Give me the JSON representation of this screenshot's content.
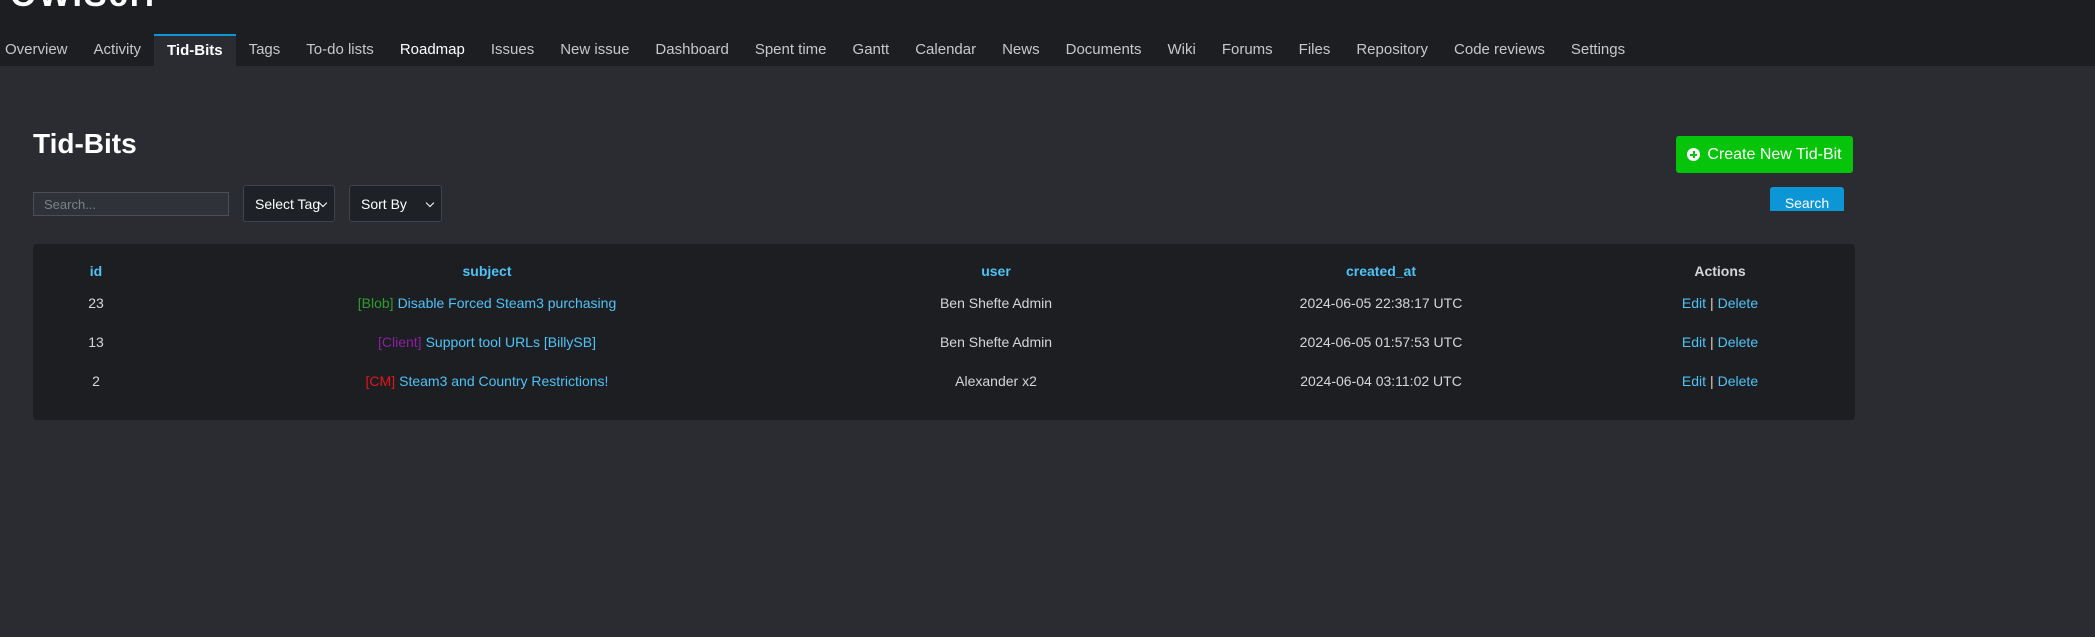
{
  "app": {
    "title": "OWIScrl"
  },
  "nav": {
    "tabs": [
      {
        "label": "Overview"
      },
      {
        "label": "Activity"
      },
      {
        "label": "Tid-Bits"
      },
      {
        "label": "Tags"
      },
      {
        "label": "To-do lists"
      },
      {
        "label": "Roadmap"
      },
      {
        "label": "Issues"
      },
      {
        "label": "New issue"
      },
      {
        "label": "Dashboard"
      },
      {
        "label": "Spent time"
      },
      {
        "label": "Gantt"
      },
      {
        "label": "Calendar"
      },
      {
        "label": "News"
      },
      {
        "label": "Documents"
      },
      {
        "label": "Wiki"
      },
      {
        "label": "Forums"
      },
      {
        "label": "Files"
      },
      {
        "label": "Repository"
      },
      {
        "label": "Code reviews"
      },
      {
        "label": "Settings"
      }
    ],
    "active": "Tid-Bits"
  },
  "page": {
    "title": "Tid-Bits",
    "create_button": "Create New Tid-Bit",
    "create_icon": "plus-circle-icon"
  },
  "filters": {
    "search_placeholder": "Search...",
    "search_value": "",
    "select_tag": "Select Tag",
    "sort_by": "Sort By",
    "search_button": "Search"
  },
  "table": {
    "headers": {
      "id": "id",
      "subject": "subject",
      "user": "user",
      "created_at": "created_at",
      "actions": "Actions"
    },
    "rows": [
      {
        "id": "23",
        "tag": "[Blob]",
        "tag_color": "#2e9e2e",
        "subject": "Disable Forced Steam3 purchasing",
        "user": "Ben Shefte Admin",
        "created_at": "2024-06-05 22:38:17 UTC",
        "edit": "Edit",
        "delete": "Delete"
      },
      {
        "id": "13",
        "tag": "[Client]",
        "tag_color": "#8e1fa0",
        "subject": "Support tool URLs [BillySB]",
        "user": "Ben Shefte Admin",
        "created_at": "2024-06-05 01:57:53 UTC",
        "edit": "Edit",
        "delete": "Delete"
      },
      {
        "id": "2",
        "tag": "[CM]",
        "tag_color": "#e8141a",
        "subject": "Steam3 and Country Restrictions!",
        "user": "Alexander x2",
        "created_at": "2024-06-04 03:11:02 UTC",
        "edit": "Edit",
        "delete": "Delete"
      }
    ],
    "separator": "|"
  },
  "colors": {
    "accent": "#0d96d6",
    "link": "#4fc3f7",
    "create_button": "#06c40a"
  }
}
